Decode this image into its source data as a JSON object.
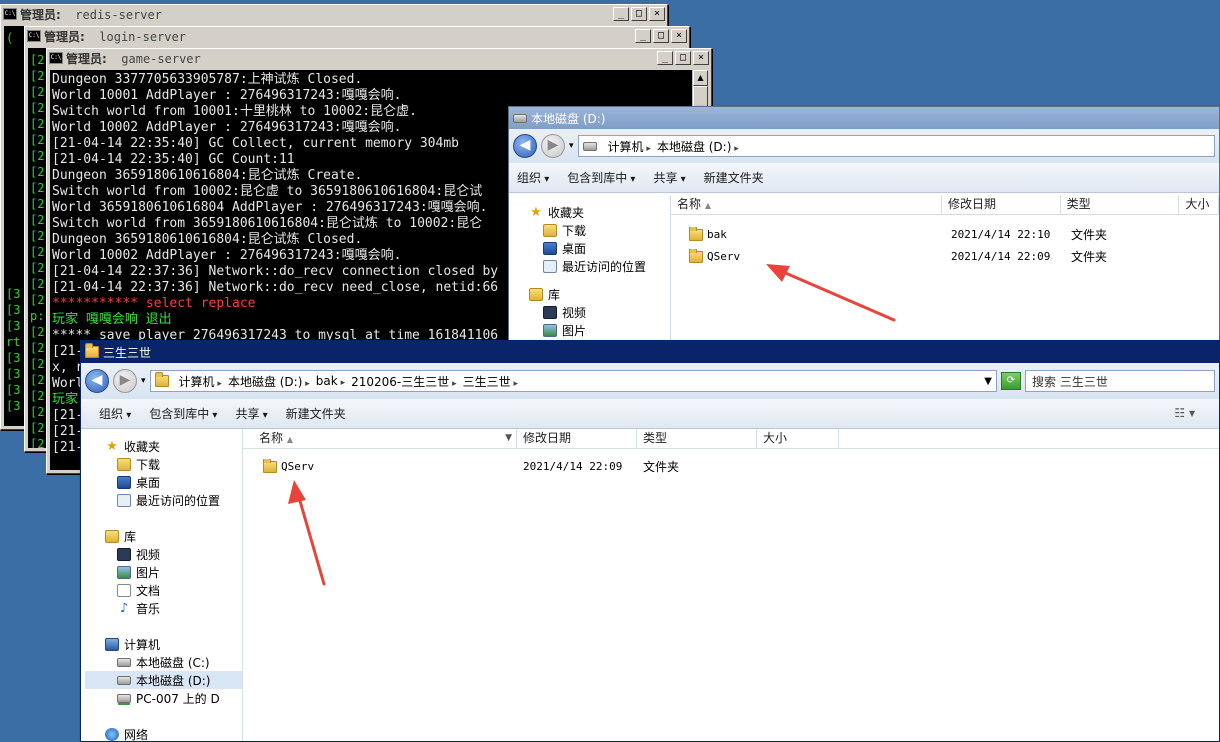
{
  "console_redis": {
    "title_prefix": "管理员:",
    "title_name": "redis-server",
    "left_lines": [
      "(",
      "",
      "",
      "",
      "",
      "",
      "",
      "",
      "",
      "",
      "",
      "",
      "",
      "",
      "",
      "",
      "[3",
      "[3",
      "[3",
      "rt",
      "[3",
      "[3",
      "[3",
      "[3"
    ]
  },
  "console_login": {
    "title_prefix": "管理员:",
    "title_name": "login-server",
    "left_lines": [
      "[2",
      "[2",
      "[2",
      "[2",
      "[2",
      "[2",
      "[2",
      "[2",
      "[2",
      "[2",
      "[2",
      "[2",
      "[2",
      "[2",
      "[2",
      "[2",
      "p:",
      "[2",
      "[2",
      "[2",
      "[2",
      "[2",
      "[2",
      "[2",
      "[2"
    ]
  },
  "console_game": {
    "title_prefix": "管理员:",
    "title_name": "game-server",
    "lines": [
      {
        "text": "Dungeon 3377705633905787:上神试炼 Closed.",
        "color": "white"
      },
      {
        "text": "World 10001 AddPlayer : 276496317243:嘎嘎会响.",
        "color": "white"
      },
      {
        "text": "Switch world from 10001:十里桃林 to 10002:昆仑虚.",
        "color": "white"
      },
      {
        "text": "World 10002 AddPlayer : 276496317243:嘎嘎会响.",
        "color": "white"
      },
      {
        "text": "[21-04-14 22:35:40] GC Collect, current memory 304mb",
        "color": "white"
      },
      {
        "text": "[21-04-14 22:35:40] GC Count:11",
        "color": "white"
      },
      {
        "text": "Dungeon 3659180610616804:昆仑试炼 Create.",
        "color": "white"
      },
      {
        "text": "Switch world from 10002:昆仑虚 to 3659180610616804:昆仑试",
        "color": "white"
      },
      {
        "text": "World 3659180610616804 AddPlayer : 276496317243:嘎嘎会响.",
        "color": "white"
      },
      {
        "text": "Switch world from 3659180610616804:昆仑试炼 to 10002:昆仑",
        "color": "white"
      },
      {
        "text": "Dungeon 3659180610616804:昆仑试炼 Closed.",
        "color": "white"
      },
      {
        "text": "World 10002 AddPlayer : 276496317243:嘎嘎会响.",
        "color": "white"
      },
      {
        "text": "[21-04-14 22:37:36] Network::do_recv connection closed by",
        "color": "white"
      },
      {
        "text": "[21-04-14 22:37:36] Network::do_recv need_close, netid:66",
        "color": "white"
      },
      {
        "text": "*********** select replace",
        "color": "red"
      },
      {
        "text": "玩家 嘎嘎会响 退出",
        "color": "green"
      },
      {
        "text": "***** save player 276496317243 to mysql at time 161841106",
        "color": "white"
      },
      {
        "text": "[21-",
        "color": "white"
      },
      {
        "text": "x, r",
        "color": "white"
      },
      {
        "text": "Worl",
        "color": "white"
      },
      {
        "text": "玩家",
        "color": "green"
      },
      {
        "text": "[21-",
        "color": "white"
      },
      {
        "text": "[21-",
        "color": "white"
      },
      {
        "text": "[21-",
        "color": "white"
      }
    ]
  },
  "explorer_d": {
    "title": "本地磁盘 (D:)",
    "address": [
      "计算机",
      "本地磁盘 (D:)"
    ],
    "toolbar": [
      "组织",
      "包含到库中",
      "共享",
      "新建文件夹"
    ],
    "nav": [
      {
        "label": "收藏夹",
        "icon": "star-icon"
      },
      {
        "label": "下载",
        "icon": "download-folder-icon"
      },
      {
        "label": "桌面",
        "icon": "desktop-icon"
      },
      {
        "label": "最近访问的位置",
        "icon": "recent-places-icon"
      },
      {
        "label": "库",
        "icon": "library-icon"
      },
      {
        "label": "视频",
        "icon": "video-icon"
      },
      {
        "label": "图片",
        "icon": "picture-icon"
      }
    ],
    "columns": [
      "名称",
      "修改日期",
      "类型",
      "大小"
    ],
    "files": [
      {
        "name": "bak",
        "date": "2021/4/14 22:10",
        "type": "文件夹"
      },
      {
        "name": "QServ",
        "date": "2021/4/14 22:09",
        "type": "文件夹"
      }
    ]
  },
  "explorer_main": {
    "title": "三生三世",
    "address": [
      "计算机",
      "本地磁盘 (D:)",
      "bak",
      "210206-三生三世",
      "三生三世"
    ],
    "search_placeholder": "搜索 三生三世",
    "toolbar": [
      "组织",
      "包含到库中",
      "共享",
      "新建文件夹"
    ],
    "nav": [
      {
        "label": "收藏夹",
        "icon": "star-icon"
      },
      {
        "label": "下载",
        "icon": "download-folder-icon"
      },
      {
        "label": "桌面",
        "icon": "desktop-icon"
      },
      {
        "label": "最近访问的位置",
        "icon": "recent-places-icon"
      },
      {
        "label": "库",
        "icon": "library-icon"
      },
      {
        "label": "视频",
        "icon": "video-icon"
      },
      {
        "label": "图片",
        "icon": "picture-icon"
      },
      {
        "label": "文档",
        "icon": "document-icon"
      },
      {
        "label": "音乐",
        "icon": "music-icon"
      },
      {
        "label": "计算机",
        "icon": "computer-icon"
      },
      {
        "label": "本地磁盘 (C:)",
        "icon": "drive-c-icon"
      },
      {
        "label": "本地磁盘 (D:)",
        "icon": "drive-d-icon"
      },
      {
        "label": "PC-007 上的 D",
        "icon": "network-drive-icon"
      },
      {
        "label": "网络",
        "icon": "network-icon"
      }
    ],
    "columns": [
      "名称",
      "修改日期",
      "类型",
      "大小"
    ],
    "files": [
      {
        "name": "QServ",
        "date": "2021/4/14 22:09",
        "type": "文件夹"
      }
    ]
  },
  "colors": {
    "desktop": "#3a6ea5",
    "annotation_arrow": "#e8443a",
    "console_text": "#e6e6e6",
    "console_green": "#38e038",
    "console_red": "#ff3c3c"
  }
}
